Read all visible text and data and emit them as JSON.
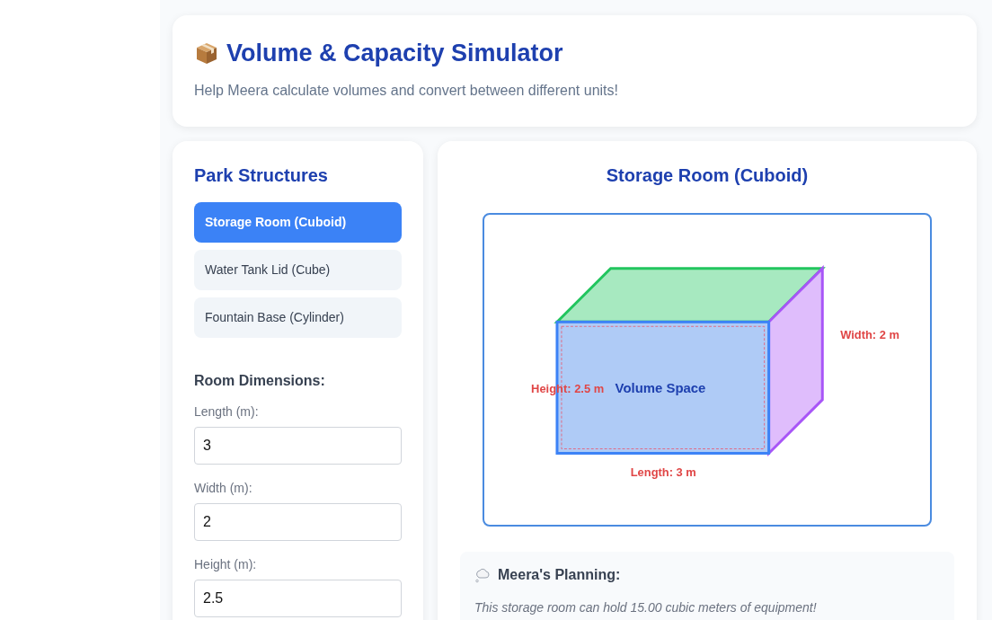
{
  "header": {
    "title": "Volume & Capacity Simulator",
    "subtitle": "Help Meera calculate volumes and convert between different units!"
  },
  "sidebar": {
    "heading": "Park Structures",
    "structures": [
      {
        "label": "Storage Room (Cuboid)",
        "selected": true
      },
      {
        "label": "Water Tank Lid (Cube)",
        "selected": false
      },
      {
        "label": "Fountain Base (Cylinder)",
        "selected": false
      }
    ],
    "dimensions_heading": "Room Dimensions:",
    "fields": [
      {
        "label": "Length (m):",
        "value": "3"
      },
      {
        "label": "Width (m):",
        "value": "2"
      },
      {
        "label": "Height (m):",
        "value": "2.5"
      }
    ]
  },
  "shape_panel": {
    "title": "Storage Room (Cuboid)",
    "diagram": {
      "center_label": "Volume Space",
      "length_label": "Length: 3 m",
      "width_label": "Width: 2 m",
      "height_label": "Height: 2.5 m"
    },
    "planning": {
      "heading": "Meera's Planning:",
      "text": "This storage room can hold 15.00 cubic meters of equipment!"
    }
  }
}
